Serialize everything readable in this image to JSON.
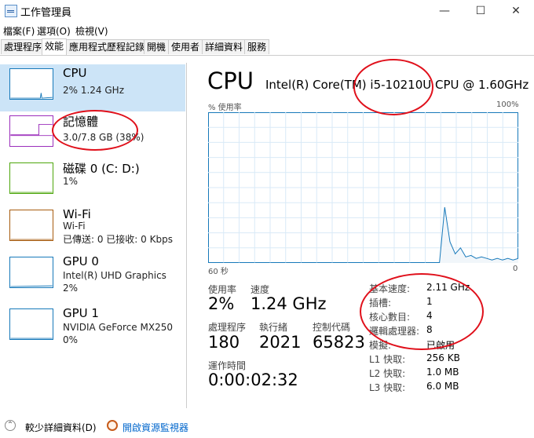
{
  "window": {
    "title": "工作管理員",
    "minimize": "—",
    "maximize": "☐",
    "close": "✕"
  },
  "menu": [
    "檔案(F)",
    "選項(O)",
    "檢視(V)"
  ],
  "tabs": [
    "處理程序",
    "效能",
    "應用程式歷程記錄",
    "開機",
    "使用者",
    "詳細資料",
    "服務"
  ],
  "active_tab": "效能",
  "resources": [
    {
      "name": "CPU",
      "line1": "2% 1.24 GHz",
      "line2": "",
      "color": "#1779ba"
    },
    {
      "name": "記憶體",
      "line1": "3.0/7.8 GB (38%)",
      "line2": "",
      "color": "#9b2ebc"
    },
    {
      "name": "磁碟 0 (C: D:)",
      "line1": "1%",
      "line2": "",
      "color": "#4da60c"
    },
    {
      "name": "Wi-Fi",
      "line1": "Wi-Fi",
      "line2": "已傳送: 0 已接收: 0 Kbps",
      "color": "#a75b0e"
    },
    {
      "name": "GPU 0",
      "line1": "Intel(R) UHD Graphics",
      "line2": "2%",
      "color": "#1779ba"
    },
    {
      "name": "GPU 1",
      "line1": "NVIDIA GeForce MX250",
      "line2": "0%",
      "color": "#1779ba"
    }
  ],
  "detail": {
    "title": "CPU",
    "model": "Intel(R) Core(TM) i5-10210U CPU @ 1.60GHz",
    "usage_label": "% 使用率",
    "usage_max": "100%",
    "time_left": "60 秒",
    "time_right": "0",
    "stats": {
      "usage_label": "使用率",
      "usage_value": "2%",
      "speed_label": "速度",
      "speed_value": "1.24 GHz",
      "processes_label": "處理程序",
      "processes_value": "180",
      "threads_label": "執行緒",
      "threads_value": "2021",
      "handles_label": "控制代碼",
      "handles_value": "65823",
      "uptime_label": "運作時間",
      "uptime_value": "0:00:02:32"
    },
    "specs": [
      {
        "label": "基本速度:",
        "value": "2.11 GHz"
      },
      {
        "label": "插槽:",
        "value": "1"
      },
      {
        "label": "核心數目:",
        "value": "4"
      },
      {
        "label": "邏輯處理器:",
        "value": "8"
      },
      {
        "label": "模擬:",
        "value": "已啟用"
      },
      {
        "label": "L1 快取:",
        "value": "256 KB"
      },
      {
        "label": "L2 快取:",
        "value": "1.0 MB"
      },
      {
        "label": "L3 快取:",
        "value": "6.0 MB"
      }
    ],
    "graph_series": [
      0,
      0,
      0,
      0,
      0,
      0,
      0,
      0,
      0,
      0,
      0,
      0,
      0,
      0,
      0,
      0,
      0,
      0,
      0,
      0,
      0,
      0,
      0,
      0,
      0,
      0,
      0,
      0,
      0,
      0,
      0,
      0,
      0,
      0,
      0,
      0,
      0,
      0,
      0,
      0,
      0,
      0,
      0,
      0,
      0,
      0,
      0,
      0,
      0,
      0,
      0,
      0,
      0,
      0,
      0,
      0,
      0,
      0,
      0,
      0,
      0,
      0,
      0,
      0,
      0,
      0,
      0,
      0,
      0,
      0,
      0,
      0,
      0,
      0,
      0,
      0,
      0,
      0,
      0,
      0,
      0,
      0,
      0,
      0,
      0,
      0,
      0,
      0,
      0,
      0,
      0,
      0,
      0,
      0,
      0,
      0,
      0,
      0,
      0,
      0,
      0,
      0,
      0,
      0,
      0,
      0,
      0,
      0,
      0,
      0,
      0,
      0,
      0,
      0,
      0,
      0,
      0,
      0,
      0,
      0,
      0,
      0,
      0,
      0,
      0,
      0,
      0,
      0,
      0,
      0,
      0,
      0,
      0,
      0,
      0,
      0,
      0,
      0,
      0,
      0,
      0,
      0,
      0,
      0,
      0,
      0,
      0,
      0,
      0,
      0,
      0,
      0,
      0,
      0,
      0,
      0,
      0,
      0,
      0,
      0,
      0,
      0,
      0,
      0,
      0,
      0,
      0,
      0,
      0,
      0,
      0,
      0,
      0,
      0,
      0,
      0,
      0,
      0,
      0,
      0,
      0,
      0,
      0,
      0,
      0,
      0,
      0,
      0,
      0,
      0,
      0,
      0,
      0,
      0,
      0,
      0,
      0,
      0,
      0,
      0,
      0,
      0,
      0,
      0,
      0,
      0,
      0,
      0,
      0,
      0,
      0,
      0,
      0,
      0,
      0,
      0,
      0,
      0,
      0,
      0,
      0,
      0,
      0,
      0,
      0,
      0,
      0,
      0,
      0,
      0,
      0,
      0,
      0,
      0,
      0,
      0,
      0,
      0,
      0,
      0,
      0,
      0,
      0,
      0,
      0,
      0,
      0,
      0,
      0,
      0,
      0,
      0,
      0,
      0,
      0,
      0,
      0,
      0,
      0,
      0,
      0,
      0,
      0,
      0,
      0,
      0,
      0,
      0,
      0,
      0,
      0,
      0,
      0,
      0,
      0,
      0,
      0,
      0,
      0,
      0,
      0,
      0,
      0,
      0,
      0,
      0,
      0,
      0,
      0,
      0,
      0,
      0,
      0,
      0,
      0,
      0,
      0,
      0,
      0,
      0,
      0,
      0,
      0,
      0,
      0,
      0,
      0,
      0,
      0,
      0,
      0,
      0,
      0,
      0,
      0,
      0,
      0,
      0,
      0,
      0,
      0,
      0,
      0,
      0,
      0,
      0,
      0,
      0,
      0,
      0,
      0,
      0,
      0,
      0,
      0,
      0,
      0,
      0,
      0,
      0,
      0,
      0,
      0,
      0,
      0,
      0,
      0,
      0,
      0,
      0,
      0,
      0,
      0,
      0,
      0,
      0,
      0,
      0,
      0,
      0,
      0,
      0,
      0,
      0,
      0,
      0,
      0,
      0,
      0,
      0,
      0,
      0,
      0,
      0,
      0,
      0,
      0,
      0,
      0,
      0,
      0,
      0,
      0,
      0,
      0,
      0,
      0,
      0,
      0,
      0,
      0,
      0,
      0,
      0,
      0,
      0,
      0,
      0,
      0,
      0,
      0,
      0,
      0,
      0,
      0,
      0,
      0,
      0
    ]
  },
  "footer": {
    "less_details": "較少詳細資料(D)",
    "resource_monitor": "開啟資源監視器"
  },
  "colors": {
    "selected_bg": "#cce4f7",
    "graph_line": "#1779ba",
    "graph_fill": "#f1f6fa",
    "annotation": "#e0101b"
  }
}
